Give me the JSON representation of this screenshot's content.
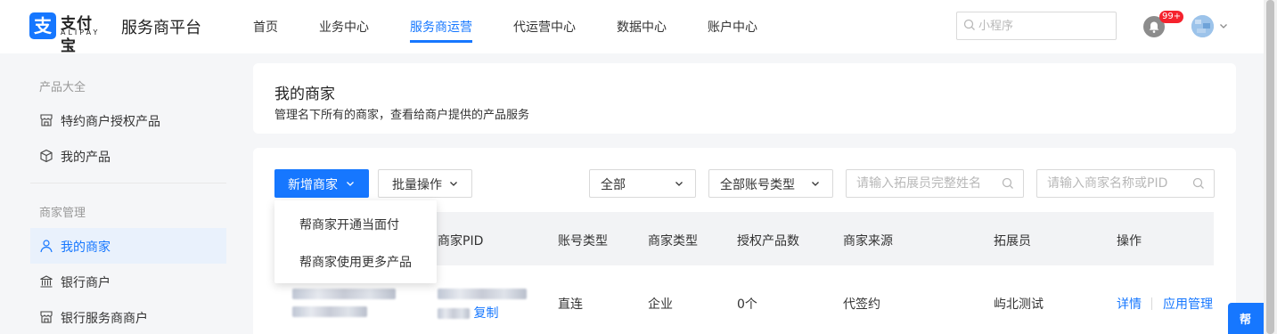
{
  "brand": {
    "logo_glyph": "支",
    "name": "支付宝",
    "sub": "ALIPAY",
    "platform": "服务商平台",
    "color": "#1677ff"
  },
  "nav": {
    "items": [
      {
        "label": "首页"
      },
      {
        "label": "业务中心"
      },
      {
        "label": "服务商运营",
        "active": true
      },
      {
        "label": "代运营中心"
      },
      {
        "label": "数据中心"
      },
      {
        "label": "账户中心"
      }
    ]
  },
  "header": {
    "search_placeholder": "小程序",
    "notification_count": "99+",
    "icons": [
      "search-icon",
      "bell-icon",
      "avatar",
      "chevron-down-icon"
    ]
  },
  "sidebar": {
    "section1": "产品大全",
    "items1": [
      {
        "label": "特约商户授权产品",
        "icon": "store-icon"
      },
      {
        "label": "我的产品",
        "icon": "cube-icon"
      }
    ],
    "section2": "商家管理",
    "items2": [
      {
        "label": "我的商家",
        "icon": "user-icon",
        "active": true
      },
      {
        "label": "银行商户",
        "icon": "bank-icon"
      },
      {
        "label": "银行服务商商户",
        "icon": "store-icon"
      }
    ]
  },
  "intro": {
    "title": "我的商家",
    "desc": "管理名下所有的商家，查看给商户提供的产品服务"
  },
  "toolbar": {
    "add_merchant": "新增商家",
    "batch": "批量操作",
    "filter_all": "全部",
    "filter_account_type": "全部账号类型",
    "expander_placeholder": "请输入拓展员完整姓名",
    "merchant_placeholder": "请输入商家名称或PID"
  },
  "dropdown": {
    "items": [
      "帮商家开通当面付",
      "帮商家使用更多产品"
    ]
  },
  "table": {
    "columns": [
      "商家PID",
      "账号类型",
      "商家类型",
      "授权产品数",
      "商家来源",
      "拓展员",
      "操作"
    ],
    "rows": [
      {
        "pid_copy": "复制",
        "account_type": "直连",
        "merchant_type": "企业",
        "product_count": "0个",
        "source": "代签约",
        "expander": "屿北测试",
        "op_detail": "详情",
        "op_manage": "应用管理"
      }
    ]
  },
  "help": {
    "label": "帮"
  }
}
